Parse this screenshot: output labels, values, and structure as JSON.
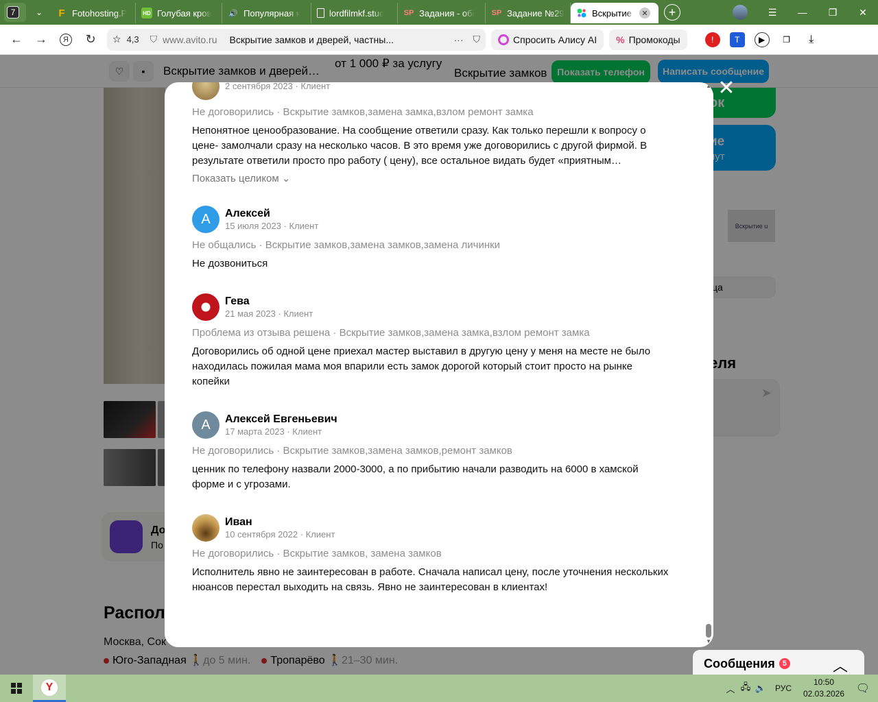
{
  "browser": {
    "tab_count": "7",
    "tabs": [
      {
        "label": "Fotohosting.P",
        "icon": "F"
      },
      {
        "label": "Голубая кров",
        "icon": "HD"
      },
      {
        "label": "Популярная к",
        "icon": "speaker"
      },
      {
        "label": "lordfilmkf.stuc",
        "icon": "doc"
      },
      {
        "label": "Задания - обі",
        "icon": "SP"
      },
      {
        "label": "Задание №29",
        "icon": "SP"
      },
      {
        "label": "Вскрытие з",
        "icon": "avito"
      }
    ],
    "rating": "4,3",
    "domain": "www.avito.ru",
    "page_title": "Вскрытие замков и дверей, частны...",
    "alice_label": "Спросить Алису AI",
    "promo_label": "Промокоды",
    "colors": {
      "frame": "#4d7d3a",
      "taskbar": "#a8c897"
    }
  },
  "page": {
    "sticky": {
      "title": "Вскрытие замков и дверей, ч...",
      "price": "от 1 000 ₽ за услугу",
      "category": "Вскрытие замков",
      "show_phone": "Показать телефон",
      "write_message": "Написать сообщение"
    },
    "side": {
      "green_text": "ок",
      "blue_line1": "ие",
      "blue_line2": "нут",
      "logo_text": "Вскрытие u",
      "chip_text": "ца",
      "heading": "еля"
    },
    "badge": {
      "title": "До",
      "subtitle": "По"
    },
    "location": {
      "title": "Распол",
      "address": "Москва, Сок",
      "metro": [
        {
          "name": "Юго-Западная",
          "walk": "до 5 мин."
        },
        {
          "name": "Тропарёво",
          "walk": "21–30 мин."
        }
      ]
    },
    "messenger": {
      "label": "Сообщения",
      "count": "5"
    }
  },
  "reviews": [
    {
      "name": "",
      "date": "2 сентября 2023 · Клиент",
      "tags": "Не договорились · Вскрытие замков,замена замка,взлом ремонт замка",
      "text": "Непонятное ценообразование. На сообщение ответили сразу. Как только перешли к вопросу о цене- замолчали сразу на несколько часов. В это время уже договорились с другой фирмой. В результате ответили просто про работу ( цену), все остальное видать будет «приятным…",
      "more": "Показать целиком ⌄"
    },
    {
      "name": "Алексей",
      "initial": "А",
      "date": "15 июля 2023 · Клиент",
      "tags": "Не общались · Вскрытие замков,замена замков,замена личинки",
      "text": "Не дозвониться"
    },
    {
      "name": "Гева",
      "date": "21 мая 2023 · Клиент",
      "tags": "Проблема из отзыва решена · Вскрытие замков,замена замка,взлом ремонт замка",
      "text": "Договорились об одной цене приехал мастер выставил в другую цену у меня на месте не было находилась пожилая мама моя впарили есть замок дорогой который стоит просто на рынке копейки"
    },
    {
      "name": "Алексей Евгеньевич",
      "initial": "А",
      "date": "17 марта 2023 · Клиент",
      "tags": "Не договорились · Вскрытие замков,замена замков,ремонт замков",
      "text": "ценник по телефону назвали 2000-3000, а по прибытию начали разводить на 6000 в хамской форме и с угрозами."
    },
    {
      "name": "Иван",
      "date": "10 сентября 2022 · Клиент",
      "tags": "Не договорились · Вскрытие замков, замена замков",
      "text": "Исполнитель явно не заинтересован в работе. Сначала написал цену, после уточнения нескольких нюансов перестал выходить на связь. Явно не заинтересован в клиентах!"
    }
  ],
  "taskbar": {
    "lang": "РУС",
    "time": "10:50",
    "date": "02.03.2026"
  }
}
